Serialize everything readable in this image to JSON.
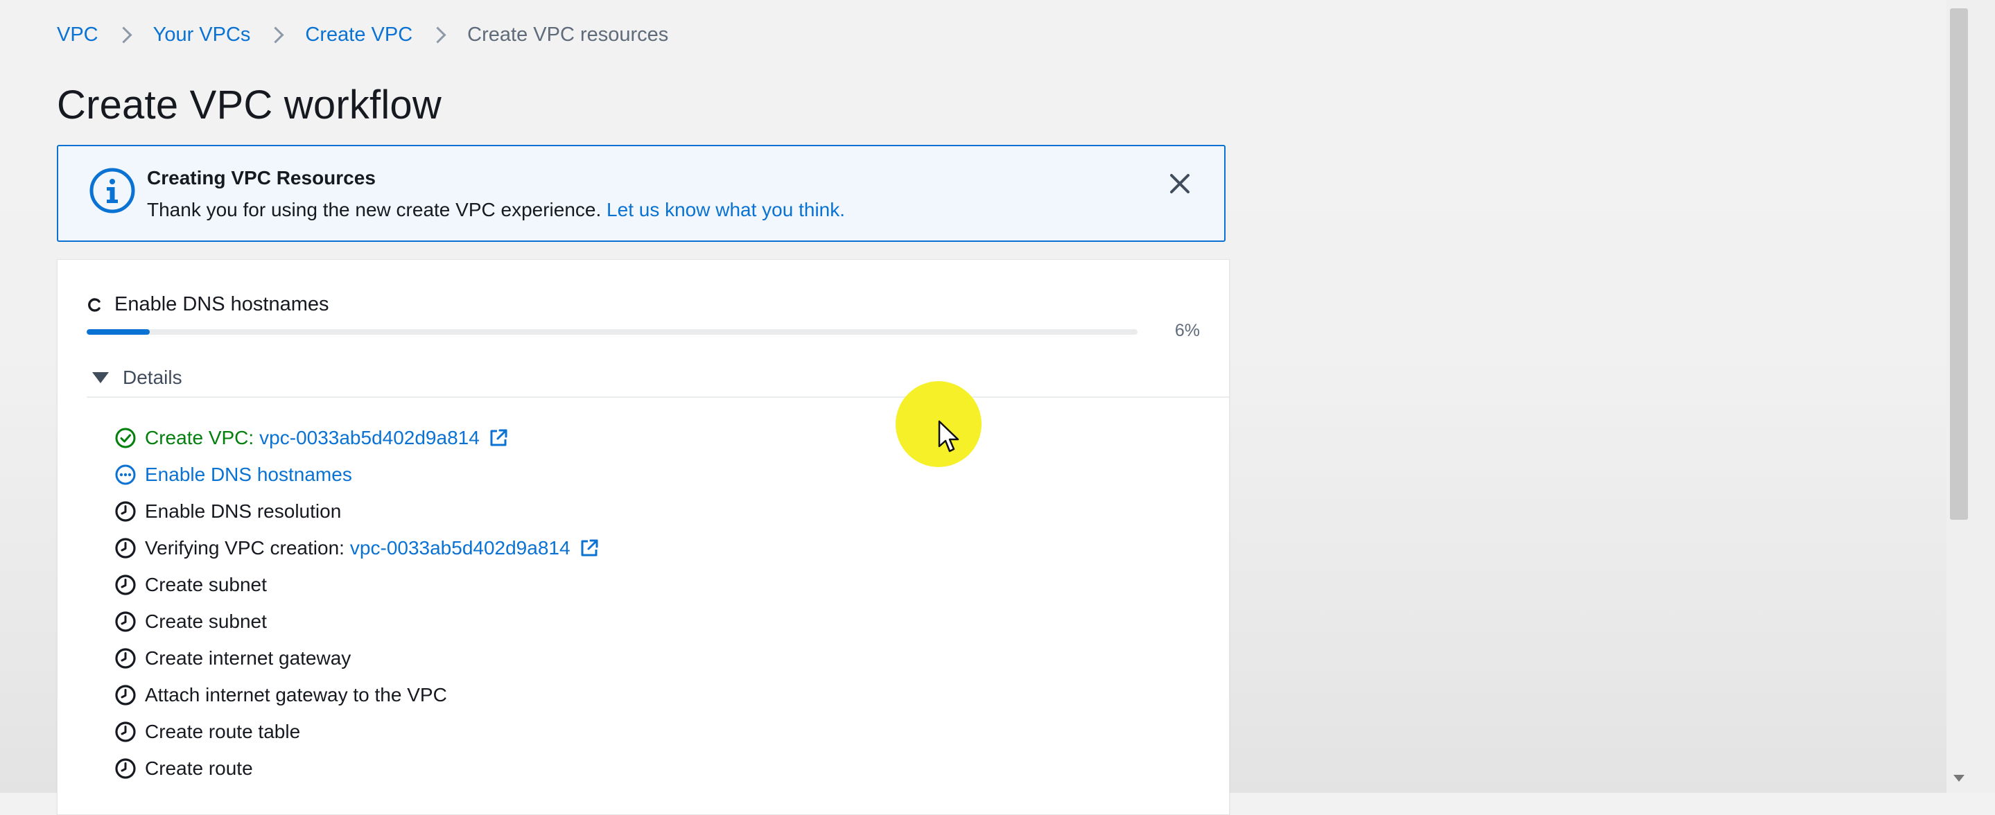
{
  "breadcrumb": {
    "items": [
      {
        "label": "VPC"
      },
      {
        "label": "Your VPCs"
      },
      {
        "label": "Create VPC"
      },
      {
        "label": "Create VPC resources"
      }
    ]
  },
  "page": {
    "title": "Create VPC workflow"
  },
  "flash": {
    "type": "info",
    "title": "Creating VPC Resources",
    "message": "Thank you for using the new create VPC experience.",
    "link_text": "Let us know what you think.",
    "icon": "info-icon",
    "dismiss_icon": "close-icon"
  },
  "progress": {
    "current_step": "Enable DNS hostnames",
    "percent": 6,
    "percent_label": "6%"
  },
  "details": {
    "label": "Details",
    "expanded": true,
    "steps": [
      {
        "status": "done",
        "icon": "check-circle-icon",
        "label": "Create VPC:",
        "link": "vpc-0033ab5d402d9a814",
        "external": true
      },
      {
        "status": "active",
        "icon": "in-progress-icon",
        "label": "Enable DNS hostnames"
      },
      {
        "status": "pending",
        "icon": "clock-icon",
        "label": "Enable DNS resolution"
      },
      {
        "status": "pending",
        "icon": "clock-icon",
        "label": "Verifying VPC creation:",
        "link": "vpc-0033ab5d402d9a814",
        "external": true
      },
      {
        "status": "pending",
        "icon": "clock-icon",
        "label": "Create subnet"
      },
      {
        "status": "pending",
        "icon": "clock-icon",
        "label": "Create subnet"
      },
      {
        "status": "pending",
        "icon": "clock-icon",
        "label": "Create internet gateway"
      },
      {
        "status": "pending",
        "icon": "clock-icon",
        "label": "Attach internet gateway to the VPC"
      },
      {
        "status": "pending",
        "icon": "clock-icon",
        "label": "Create route table"
      },
      {
        "status": "pending",
        "icon": "clock-icon",
        "label": "Create route"
      }
    ]
  },
  "colors": {
    "link": "#0972d3",
    "success": "#037f0c",
    "flash_bg": "#f1f7fc",
    "cursor_highlight": "#f6ef1d"
  }
}
